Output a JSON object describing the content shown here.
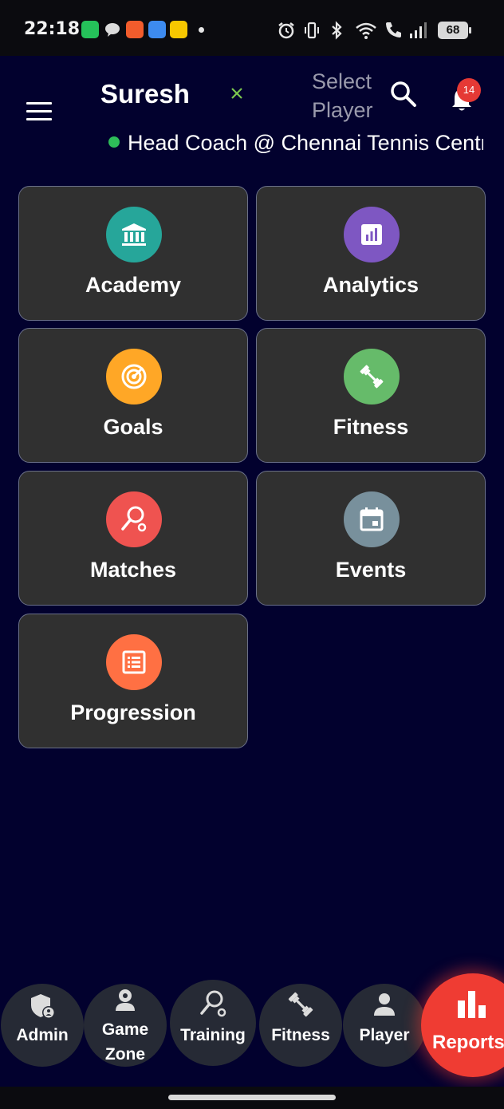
{
  "status_bar": {
    "time": "22:18",
    "battery": "68",
    "apps": [
      "whatsapp-icon",
      "chat-icon",
      "swiggy-icon",
      "files-icon",
      "rapido-icon"
    ]
  },
  "header": {
    "user_name": "Suresh",
    "select_player_label": "Select Player",
    "notification_count": "14",
    "role_text": "Head Coach @ Chennai Tennis Centre"
  },
  "tiles": [
    {
      "label": "Academy",
      "icon": "bank-icon",
      "color": "#26a69a"
    },
    {
      "label": "Analytics",
      "icon": "analytics-icon",
      "color": "#7e57c2"
    },
    {
      "label": "Goals",
      "icon": "target-icon",
      "color": "#ffa726"
    },
    {
      "label": "Fitness",
      "icon": "dumbbell-icon",
      "color": "#66bb6a"
    },
    {
      "label": "Matches",
      "icon": "racket-icon",
      "color": "#ef5350"
    },
    {
      "label": "Events",
      "icon": "calendar-icon",
      "color": "#78909c"
    },
    {
      "label": "Progression",
      "icon": "list-icon",
      "color": "#ff7043"
    }
  ],
  "bottom_nav": {
    "admin": "Admin",
    "game_zone_line1": "Game",
    "game_zone_line2": "Zone",
    "training": "Training",
    "fitness": "Fitness",
    "player": "Player",
    "reports": "Reports"
  },
  "colors": {
    "background": "#02012e",
    "tile": "#303030",
    "tile_border": "#6a7088",
    "nav_button": "#262a35",
    "reports_accent": "#ef3c33",
    "online": "#2ebd59",
    "clear_x": "#7bc74d"
  }
}
